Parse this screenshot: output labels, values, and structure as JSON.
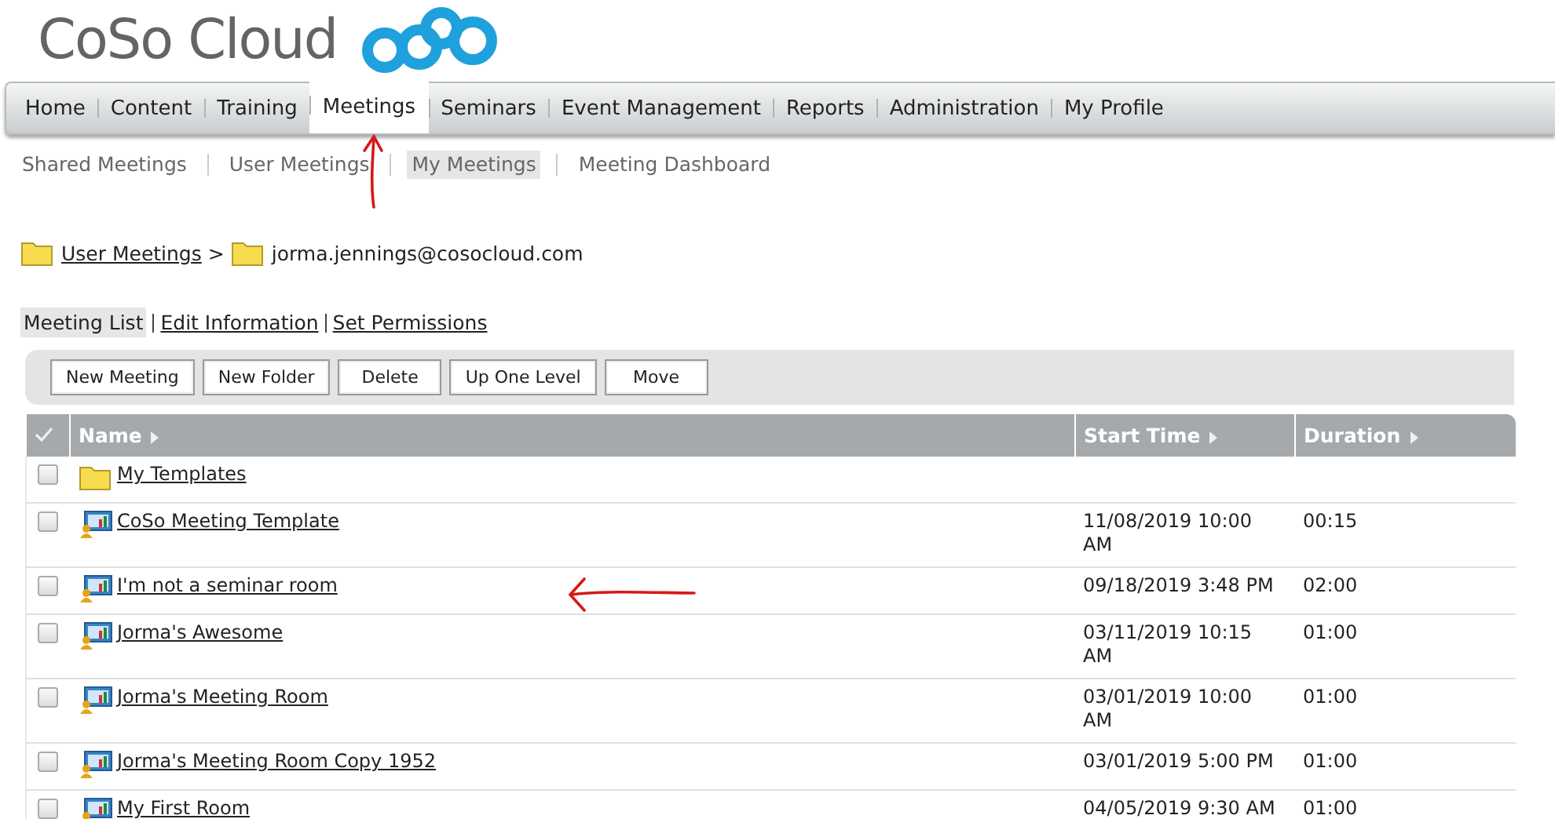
{
  "logo": {
    "text": "CoSo Cloud"
  },
  "nav": [
    {
      "label": "Home",
      "selected": false
    },
    {
      "label": "Content",
      "selected": false
    },
    {
      "label": "Training",
      "selected": false
    },
    {
      "label": "Meetings",
      "selected": true
    },
    {
      "label": "Seminars",
      "selected": false
    },
    {
      "label": "Event Management",
      "selected": false
    },
    {
      "label": "Reports",
      "selected": false
    },
    {
      "label": "Administration",
      "selected": false
    },
    {
      "label": "My Profile",
      "selected": false
    }
  ],
  "subnav": [
    {
      "label": "Shared Meetings",
      "selected": false
    },
    {
      "label": "User Meetings",
      "selected": false
    },
    {
      "label": "My Meetings",
      "selected": true
    },
    {
      "label": "Meeting Dashboard",
      "selected": false
    }
  ],
  "breadcrumb": {
    "parent": "User Meetings",
    "separator": ">",
    "current": "jorma.jennings@cosocloud.com"
  },
  "view_tabs": [
    {
      "label": "Meeting List",
      "selected": true
    },
    {
      "label": "Edit Information",
      "selected": false
    },
    {
      "label": "Set Permissions",
      "selected": false
    }
  ],
  "toolbar": [
    "New Meeting",
    "New Folder",
    "Delete",
    "Up One Level",
    "Move"
  ],
  "table": {
    "columns": [
      "Name",
      "Start Time",
      "Duration"
    ],
    "rows": [
      {
        "kind": "folder",
        "checked": false,
        "name": "My Templates"
      },
      {
        "kind": "meeting",
        "checked": false,
        "name": "CoSo Meeting Template",
        "start_time": "11/08/2019 10:00 AM",
        "duration": "00:15"
      },
      {
        "kind": "meeting",
        "checked": false,
        "name": "I'm not a seminar room",
        "start_time": "09/18/2019 3:48 PM",
        "duration": "02:00"
      },
      {
        "kind": "meeting",
        "checked": false,
        "name": "Jorma's Awesome",
        "start_time": "03/11/2019 10:15 AM",
        "duration": "01:00"
      },
      {
        "kind": "meeting",
        "checked": false,
        "name": "Jorma's Meeting Room",
        "start_time": "03/01/2019 10:00 AM",
        "duration": "01:00"
      },
      {
        "kind": "meeting",
        "checked": false,
        "name": "Jorma's Meeting Room Copy 1952",
        "start_time": "03/01/2019 5:00 PM",
        "duration": "01:00"
      },
      {
        "kind": "meeting",
        "checked": false,
        "name": "My First Room",
        "start_time": "04/05/2019 9:30 AM",
        "duration": "01:00"
      }
    ]
  }
}
